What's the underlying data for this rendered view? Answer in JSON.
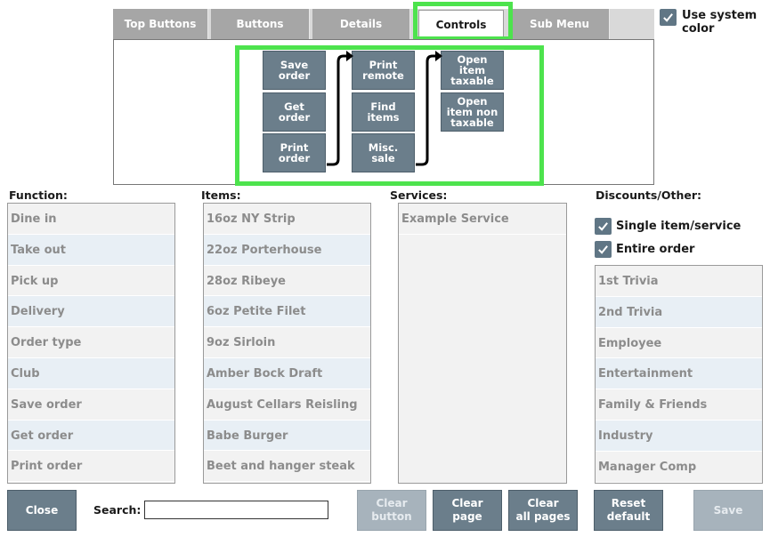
{
  "tabs": [
    {
      "label": "Top Buttons"
    },
    {
      "label": "Buttons"
    },
    {
      "label": "Details"
    },
    {
      "label": "Controls",
      "active": true
    },
    {
      "label": "Sub Menu"
    }
  ],
  "use_system_color": {
    "label_line1": "Use system",
    "label_line2": "color",
    "checked": true
  },
  "preview": {
    "col1": [
      {
        "line1": "Save",
        "line2": "order"
      },
      {
        "line1": "Get",
        "line2": "order"
      },
      {
        "line1": "Print",
        "line2": "order"
      }
    ],
    "col2": [
      {
        "line1": "Print",
        "line2": "remote"
      },
      {
        "line1": "Find",
        "line2": "items"
      },
      {
        "line1": "Misc.",
        "line2": "sale"
      }
    ],
    "col3": [
      {
        "line1": "Open",
        "line2": "item",
        "line3": "taxable"
      },
      {
        "line1": "Open",
        "line2": "item non",
        "line3": "taxable"
      }
    ]
  },
  "columns": {
    "function": {
      "heading": "Function:",
      "items": [
        "Dine in",
        "Take out",
        "Pick up",
        "Delivery",
        "Order type",
        "Club",
        "Save order",
        "Get order",
        "Print order"
      ]
    },
    "items": {
      "heading": "Items:",
      "items": [
        "16oz NY Strip",
        "22oz Porterhouse",
        "28oz Ribeye",
        "6oz Petite Filet",
        "9oz Sirloin",
        "Amber Bock Draft",
        "August Cellars Reisling",
        "Babe Burger",
        "Beet and hanger steak"
      ]
    },
    "services": {
      "heading": "Services:",
      "items": [
        "Example Service"
      ]
    },
    "discounts": {
      "heading": "Discounts/Other:",
      "single_item_label": "Single item/service",
      "entire_order_label": "Entire order",
      "items": [
        "1st Trivia",
        "2nd Trivia",
        "Employee",
        "Entertainment",
        "Family & Friends",
        "Industry",
        "Manager Comp"
      ]
    }
  },
  "bottom": {
    "close": "Close",
    "search_label": "Search:",
    "search_value": "",
    "clear_button": {
      "line1": "Clear",
      "line2": "button"
    },
    "clear_page": {
      "line1": "Clear",
      "line2": "page"
    },
    "clear_all_pages": {
      "line1": "Clear",
      "line2": "all pages"
    },
    "reset_default": {
      "line1": "Reset",
      "line2": "default"
    },
    "save": "Save"
  },
  "colors": {
    "accent_highlight": "#4de34d",
    "button": "#6b7e8b",
    "tab": "#a6a6a6"
  }
}
